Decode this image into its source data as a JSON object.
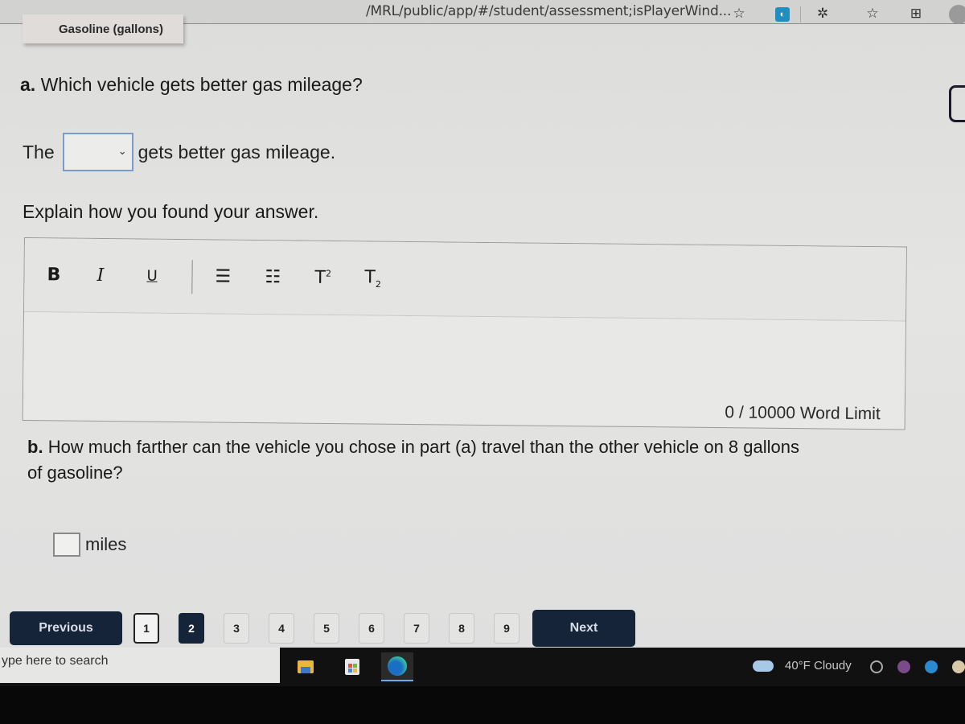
{
  "browser": {
    "url": "/MRL/public/app/#/student/assessment;isPlayerWind...",
    "icons": [
      "add-favorite-icon",
      "extension-icon",
      "extensions-puzzle-icon",
      "favorites-icon",
      "collections-icon",
      "profile-icon"
    ]
  },
  "chart_label": "Gasoline (gallons)",
  "question_a": {
    "label": "a.",
    "text": "Which vehicle gets better gas mileage?",
    "sentence_prefix": "The",
    "select_value": "",
    "sentence_suffix": "gets better gas mileage."
  },
  "explain": {
    "prompt": "Explain how you found your answer.",
    "toolbar": {
      "bold": "B",
      "italic": "I",
      "underline": "U",
      "bullet_list": "☰",
      "numbered_list": "☷",
      "superscript": "T",
      "subscript": "T",
      "sup_mark": "2",
      "sub_mark": "2"
    },
    "value": "",
    "word_limit": "0 / 10000 Word Limit"
  },
  "question_b": {
    "label": "b.",
    "text": "How much farther can the vehicle you chose in part (a) travel than the other vehicle on 8 gallons of gasoline?",
    "input_value": "",
    "unit": "miles"
  },
  "pager": {
    "previous": "Previous",
    "next": "Next",
    "pages": [
      "1",
      "2",
      "3",
      "4",
      "5",
      "6",
      "7",
      "8",
      "9"
    ],
    "current": "2"
  },
  "taskbar": {
    "search_placeholder": "ype here to search",
    "weather": "40°F  Cloudy"
  }
}
